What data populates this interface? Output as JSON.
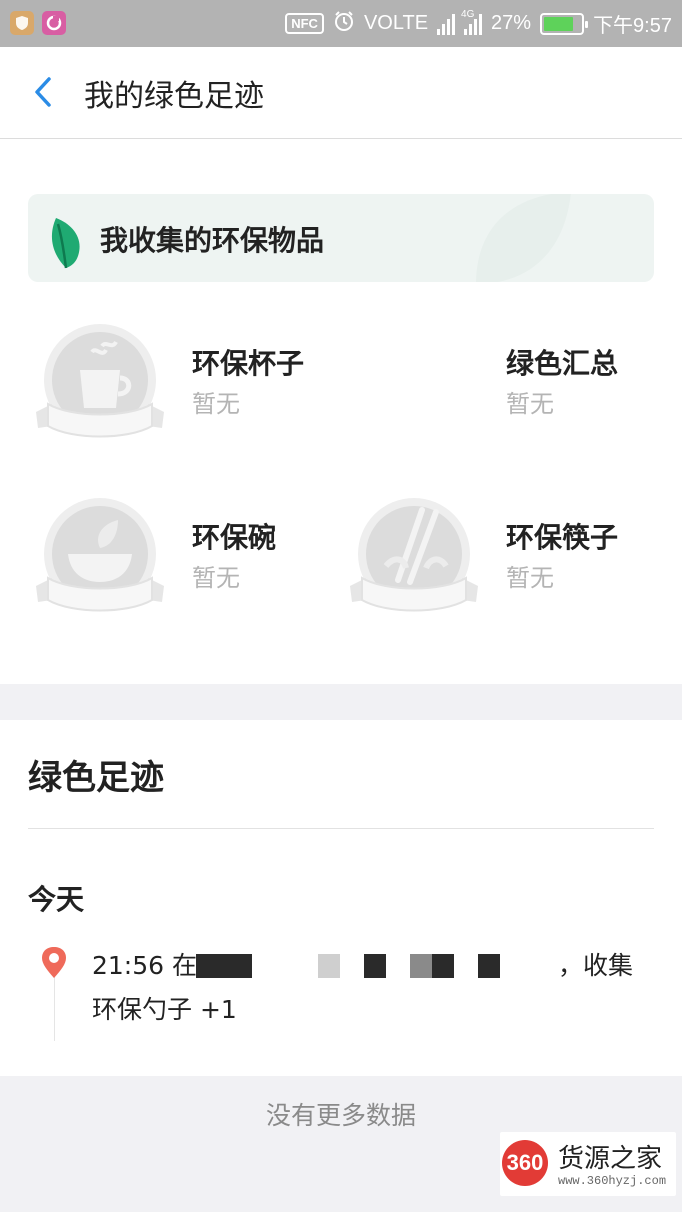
{
  "status_bar": {
    "nfc": "NFC",
    "volte": "VOLTE",
    "network": "4G",
    "battery_percent_text": "27%",
    "battery_level": 0.27,
    "time": "下午9:57"
  },
  "header": {
    "title": "我的绿色足迹"
  },
  "collection": {
    "title": "我收集的环保物品",
    "items": [
      {
        "name": "环保杯子",
        "status": "暂无",
        "icon": "cup-badge-icon"
      },
      {
        "name": "绿色汇总",
        "status": "暂无",
        "icon": ""
      },
      {
        "name": "环保碗",
        "status": "暂无",
        "icon": "bowl-badge-icon"
      },
      {
        "name": "环保筷子",
        "status": "暂无",
        "icon": "chopsticks-badge-icon"
      }
    ]
  },
  "footprint": {
    "title": "绿色足迹",
    "day_label": "今天",
    "entries": [
      {
        "time_prefix": "21:56 在",
        "suffix": "，收集",
        "line2": "环保勺子 +1"
      }
    ]
  },
  "footer": {
    "no_more_text": "没有更多数据"
  },
  "watermark": {
    "logo_text": "360",
    "name": "货源之家",
    "url": "www.360hyzj.com"
  },
  "colors": {
    "accent_blue": "#2b8ce6",
    "leaf_green": "#1faa72",
    "pin_red": "#ef6a5a",
    "banner_bg": "#eef4f2"
  }
}
